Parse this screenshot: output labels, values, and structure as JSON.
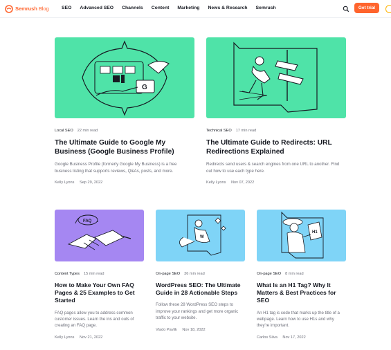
{
  "header": {
    "logo_brand": "Semrush",
    "logo_suffix": "Blog",
    "nav": [
      "SEO",
      "Advanced SEO",
      "Channels",
      "Content",
      "Marketing",
      "News & Research",
      "Semrush"
    ],
    "trial_label": "Get trial"
  },
  "colors": {
    "brand": "#ff642d",
    "green_thumb": "#4fe3a8",
    "purple_thumb": "#a587f2",
    "blue_thumb": "#7fd4f7"
  },
  "articles": [
    {
      "category": "Local SEO",
      "read_time": "22 min read",
      "title": "The Ultimate Guide to Google My Business (Google Business Profile)",
      "description": "Google Business Profile (formerly Google My Business) is a free business listing that supports reviews, Q&As, posts, and more.",
      "author": "Kelly Lyons",
      "date": "Sep 29, 2022",
      "thumb_icon": "google-business-illustration"
    },
    {
      "category": "Technical SEO",
      "read_time": "17 min read",
      "title": "The Ultimate Guide to Redirects: URL Redirections Explained",
      "description": "Redirects send users & search engines from one URL to another. Find out how to use each type here.",
      "author": "Kelly Lyons",
      "date": "Nov 07, 2022",
      "thumb_icon": "signpost-illustration"
    },
    {
      "category": "Content Types",
      "read_time": "15 min read",
      "title": "How to Make Your Own FAQ Pages & 25 Examples to Get Started",
      "description": "FAQ pages allow you to address common customer issues. Learn the ins and outs of creating an FAQ page.",
      "author": "Kelly Lyons",
      "date": "Nov 21, 2022",
      "thumb_icon": "handshake-faq-illustration"
    },
    {
      "category": "On-page SEO",
      "read_time": "36 min read",
      "title": "WordPress SEO: The Ultimate Guide in 28 Actionable Steps",
      "description": "Follow these 28 WordPress SEO steps to improve your rankings and get more organic traffic to your website.",
      "author": "Vlado Pavlik",
      "date": "Nov 18, 2022",
      "thumb_icon": "wordpress-hero-illustration"
    },
    {
      "category": "On-page SEO",
      "read_time": "8 min read",
      "title": "What Is an H1 Tag? Why It Matters & Best Practices for SEO",
      "description": "An H1 tag is code that marks up the title of a webpage. Learn how to use H1s and why they're important.",
      "author": "Carlos Silva",
      "date": "Nov 17, 2022",
      "thumb_icon": "h1-person-illustration"
    }
  ]
}
